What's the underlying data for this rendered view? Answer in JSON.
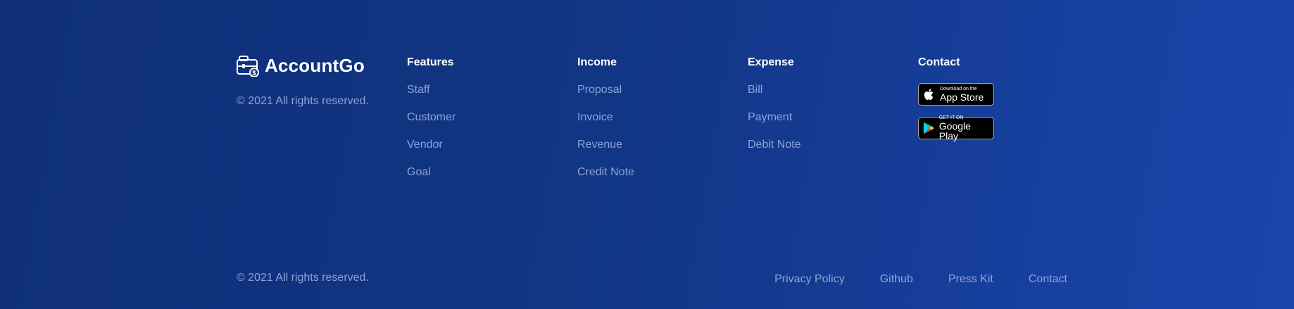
{
  "brand": {
    "name": "AccountGo",
    "copyright": "© 2021 All rights reserved."
  },
  "columns": {
    "features": {
      "title": "Features",
      "items": [
        "Staff",
        "Customer",
        "Vendor",
        "Goal"
      ]
    },
    "income": {
      "title": "Income",
      "items": [
        "Proposal",
        "Invoice",
        "Revenue",
        "Credit Note"
      ]
    },
    "expense": {
      "title": "Expense",
      "items": [
        "Bill",
        "Payment",
        "Debit Note"
      ]
    },
    "contact": {
      "title": "Contact",
      "app_store": {
        "small": "Download on the",
        "big": "App Store",
        "icon": "apple-icon"
      },
      "google_play": {
        "small": "GET IT ON",
        "big": "Google Play",
        "icon": "google-play-icon"
      }
    }
  },
  "bottom": {
    "copyright": "© 2021 All rights reserved.",
    "links": [
      "Privacy Policy",
      "Github",
      "Press Kit",
      "Contact"
    ]
  },
  "colors": {
    "background_start": "#0f2f78",
    "background_end": "#1945ad",
    "link": "#8ea2d8",
    "heading": "#ffffff"
  }
}
